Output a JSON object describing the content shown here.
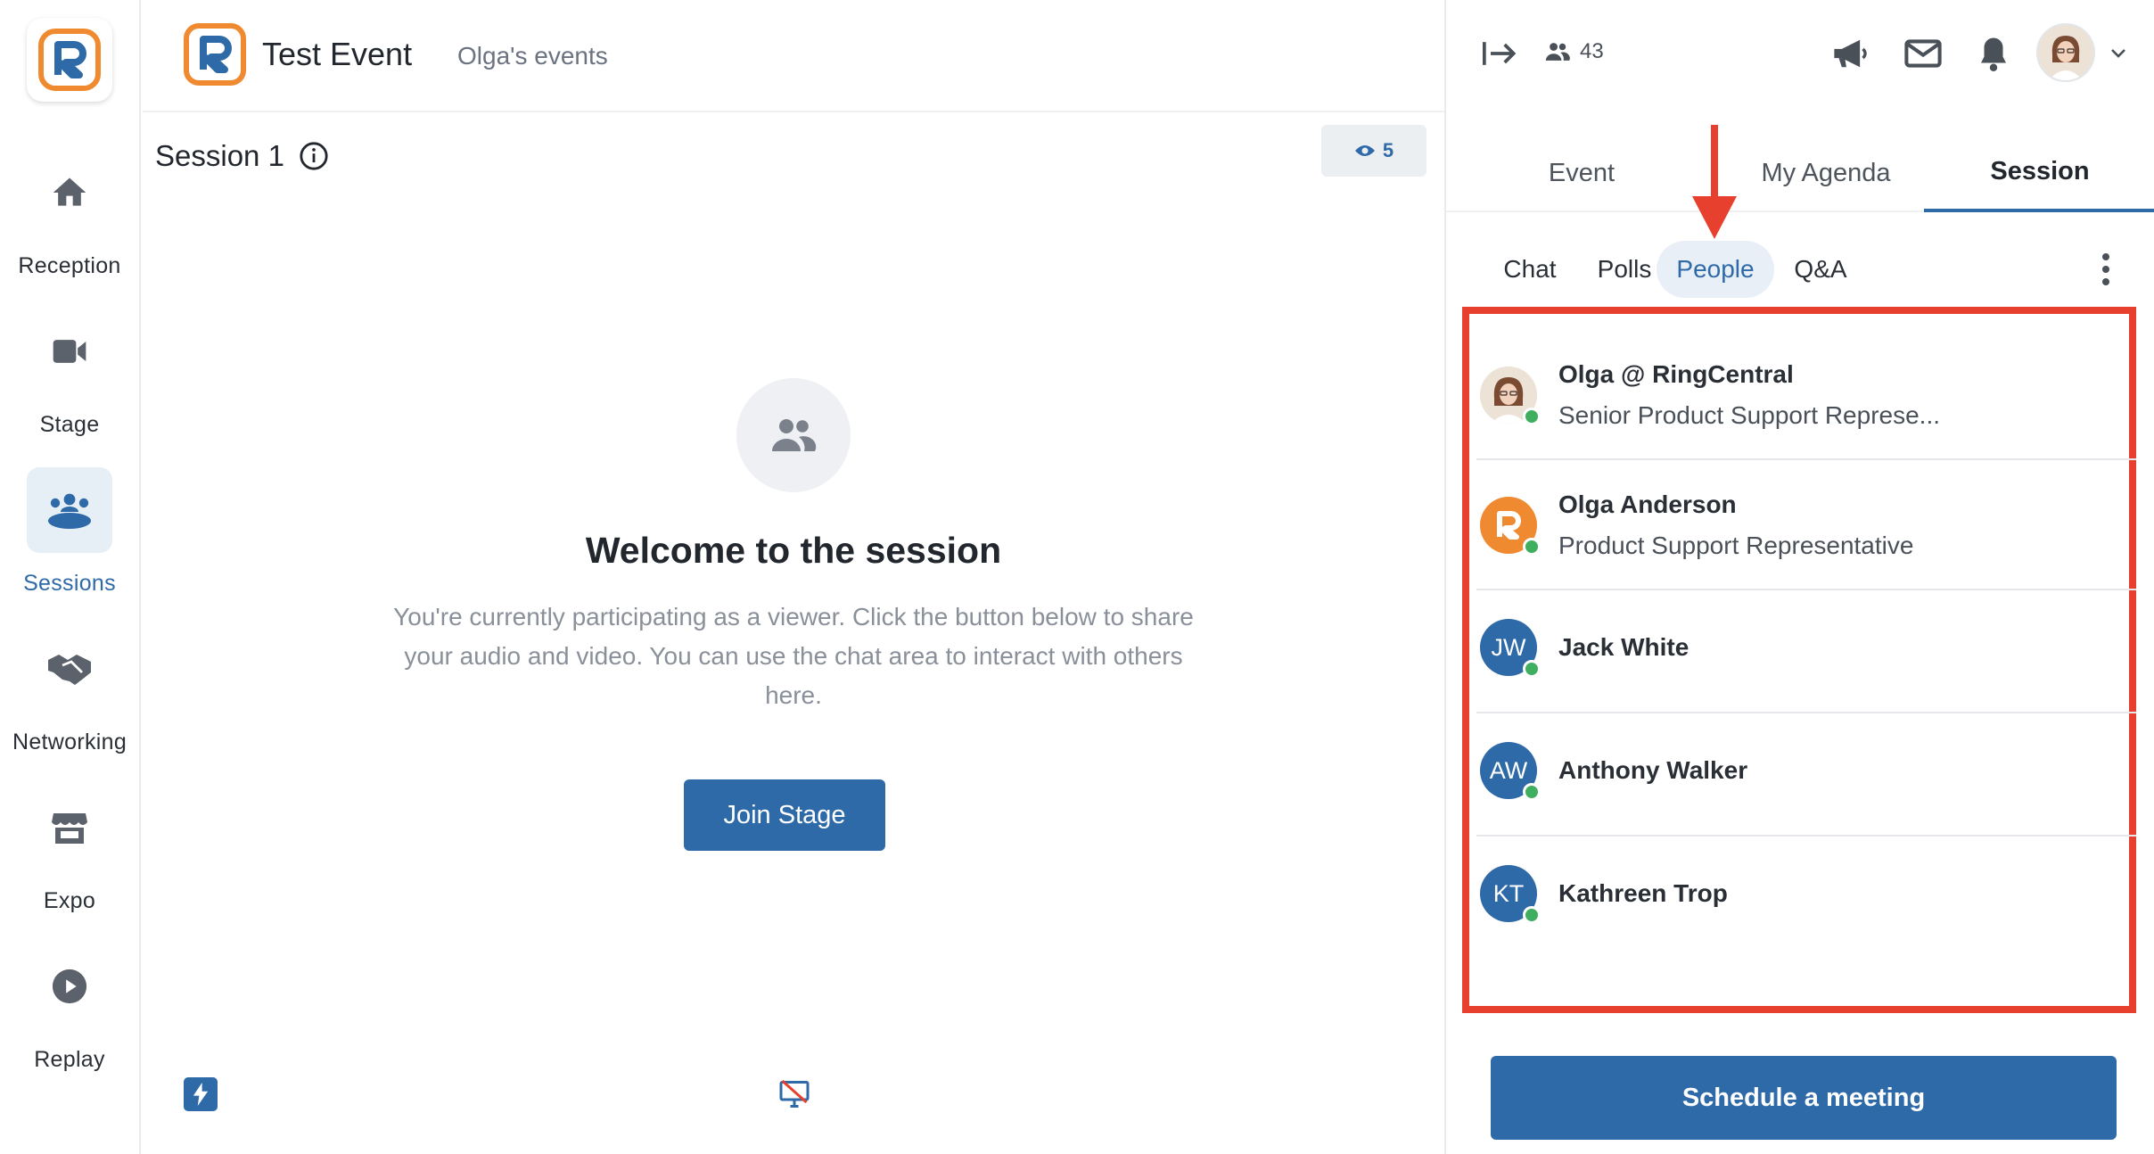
{
  "nav": {
    "items": [
      {
        "label": "Reception",
        "icon": "home-icon",
        "active": false
      },
      {
        "label": "Stage",
        "icon": "video-camera-icon",
        "active": false
      },
      {
        "label": "Sessions",
        "icon": "sessions-group-icon",
        "active": true
      },
      {
        "label": "Networking",
        "icon": "handshake-icon",
        "active": false
      },
      {
        "label": "Expo",
        "icon": "booth-icon",
        "active": false
      },
      {
        "label": "Replay",
        "icon": "play-circle-icon",
        "active": false
      }
    ]
  },
  "header": {
    "event_title": "Test Event",
    "org_link": "Olga's events"
  },
  "session": {
    "title": "Session 1",
    "viewer_count": "5"
  },
  "welcome": {
    "title": "Welcome to the session",
    "text": "You're currently participating as a viewer. Click the button below to share your audio and video. You can use the chat area to interact with others here.",
    "join_label": "Join Stage"
  },
  "rightpanel": {
    "people_count": "43",
    "tabs": [
      {
        "label": "Event",
        "active": false
      },
      {
        "label": "My Agenda",
        "active": false
      },
      {
        "label": "Session",
        "active": true
      }
    ],
    "subtabs": [
      {
        "label": "Chat",
        "active": false
      },
      {
        "label": "Polls",
        "active": false
      },
      {
        "label": "People",
        "active": true
      },
      {
        "label": "Q&A",
        "active": false
      }
    ],
    "people": [
      {
        "name": "Olga @ RingCentral",
        "role": "Senior Product Support Represe...",
        "initials": "",
        "avatar": "photo",
        "online": true
      },
      {
        "name": "Olga Anderson",
        "role": "Product Support Representative",
        "initials": "",
        "avatar": "logo",
        "online": true
      },
      {
        "name": "Jack White",
        "role": "",
        "initials": "JW",
        "avatar": "initials",
        "online": true
      },
      {
        "name": "Anthony Walker",
        "role": "",
        "initials": "AW",
        "avatar": "initials",
        "online": true
      },
      {
        "name": "Kathreen Trop",
        "role": "",
        "initials": "KT",
        "avatar": "initials",
        "online": true
      }
    ],
    "schedule_label": "Schedule a meeting"
  },
  "colors": {
    "accent": "#2f6aa8",
    "brand_orange": "#f08a30",
    "annotation_red": "#e8402e",
    "online": "#3fae5f"
  }
}
